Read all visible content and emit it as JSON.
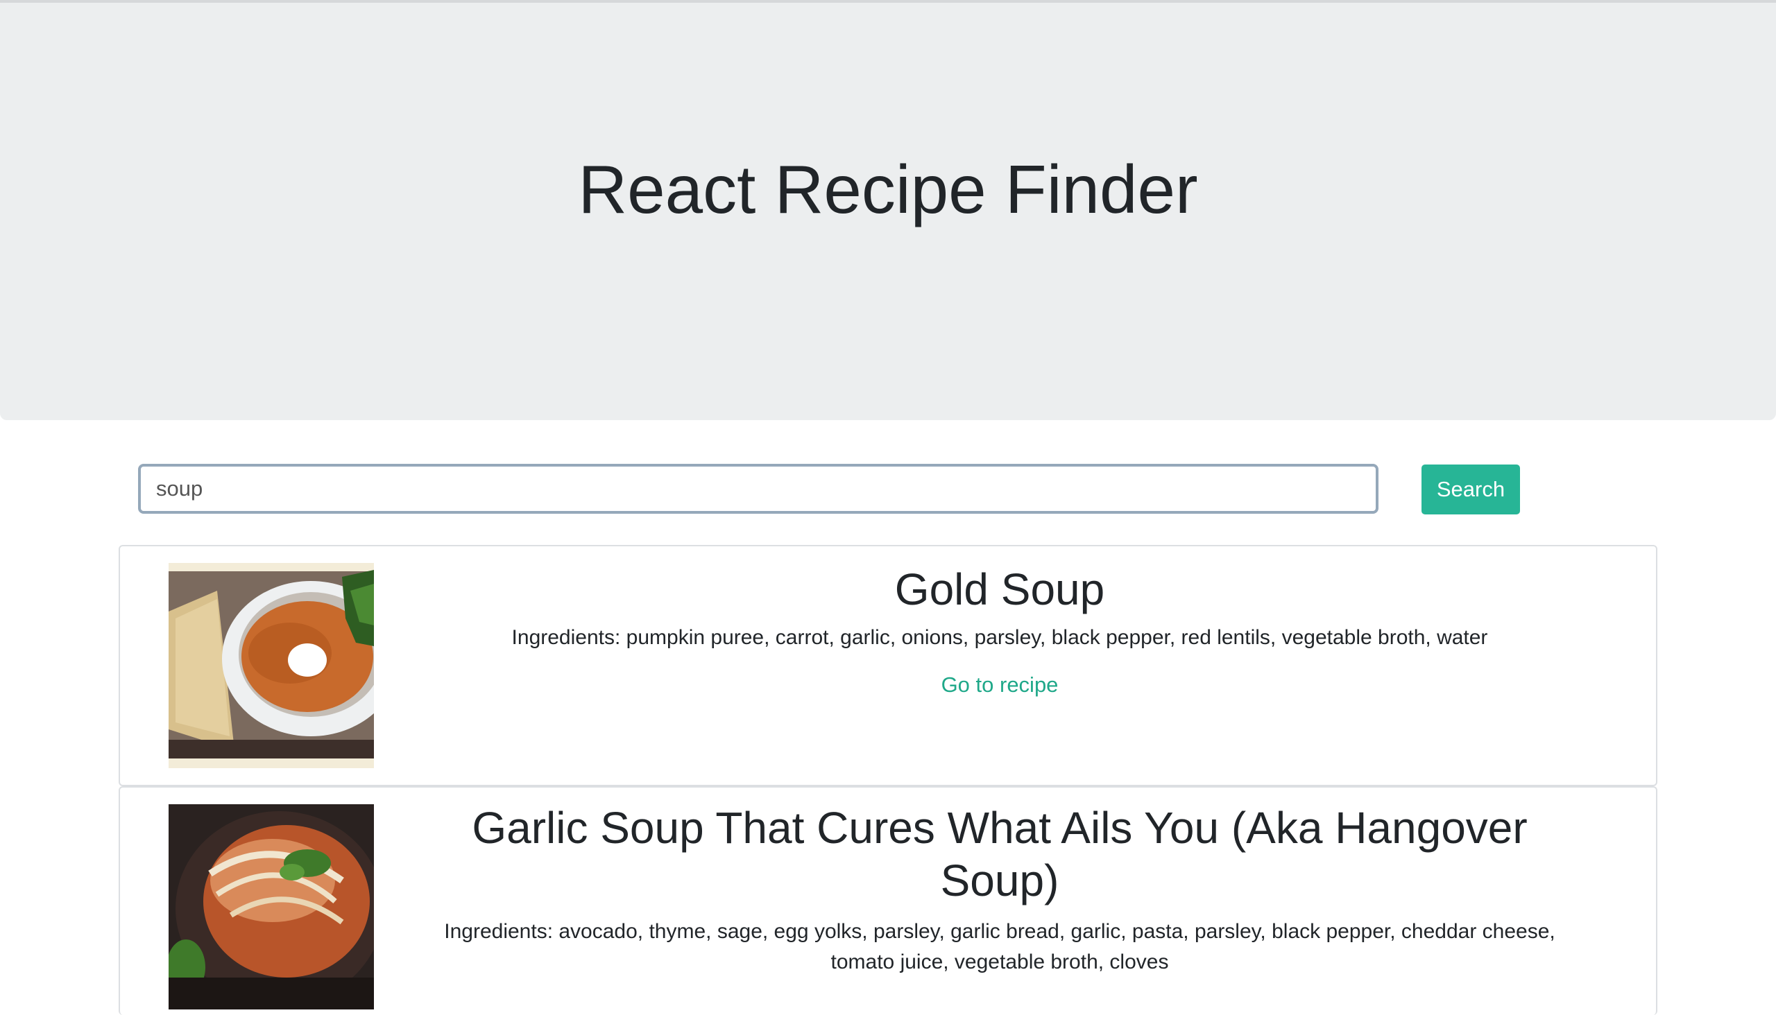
{
  "header": {
    "title": "React Recipe Finder"
  },
  "search": {
    "value": "soup",
    "button_label": "Search"
  },
  "recipes": [
    {
      "title": "Gold Soup",
      "ingredients": "Ingredients: pumpkin puree, carrot, garlic, onions, parsley, black pepper, red lentils, vegetable broth, water",
      "link_label": "Go to recipe"
    },
    {
      "title": "Garlic Soup That Cures What Ails You (Aka Hangover Soup)",
      "ingredients": "Ingredients: avocado, thyme, sage, egg yolks, parsley, garlic bread, garlic, pasta, parsley, black pepper, cheddar cheese, tomato juice, vegetable broth, cloves"
    }
  ],
  "colors": {
    "accent": "#27b596",
    "link": "#1fa889",
    "jumbotron_bg": "#eceeef"
  }
}
